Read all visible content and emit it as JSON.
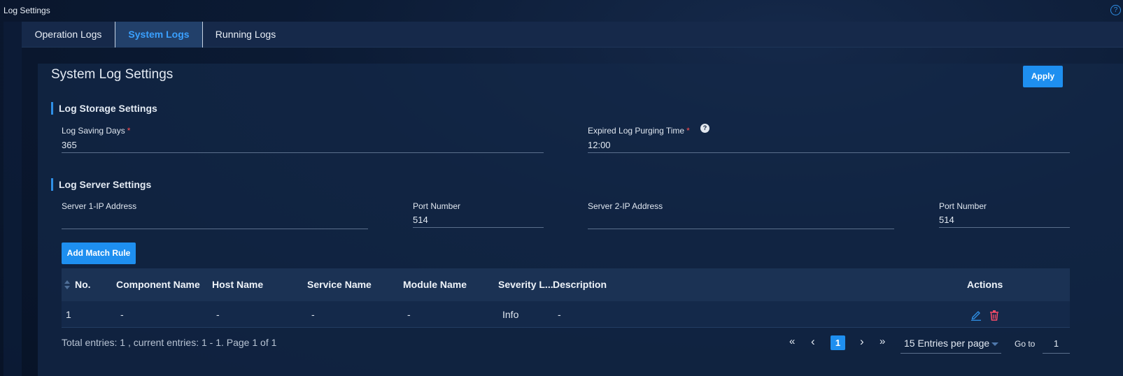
{
  "window": {
    "title": "Log Settings",
    "help_glyph": "?"
  },
  "tabs": [
    {
      "label": "Operation Logs",
      "active": false
    },
    {
      "label": "System Logs",
      "active": true
    },
    {
      "label": "Running Logs",
      "active": false
    }
  ],
  "panel": {
    "title": "System Log Settings",
    "apply_label": "Apply"
  },
  "storage": {
    "heading": "Log Storage Settings",
    "saving_days": {
      "label": "Log Saving Days",
      "required": "*",
      "value": "365"
    },
    "purging_time": {
      "label": "Expired Log Purging Time",
      "required": "*",
      "value": "12:00",
      "help_glyph": "?"
    }
  },
  "server": {
    "heading": "Log Server Settings",
    "server1_ip": {
      "label": "Server 1-IP Address",
      "value": ""
    },
    "server1_port": {
      "label": "Port Number",
      "value": "514"
    },
    "server2_ip": {
      "label": "Server 2-IP Address",
      "value": ""
    },
    "server2_port": {
      "label": "Port Number",
      "value": "514"
    }
  },
  "rules": {
    "add_label": "Add Match Rule",
    "columns": [
      "No.",
      "Component Name",
      "Host Name",
      "Service Name",
      "Module Name",
      "Severity L...",
      "Description",
      "Actions"
    ],
    "rows": [
      {
        "no": "1",
        "component": "-",
        "host": "-",
        "service": "-",
        "module": "-",
        "severity": "Info",
        "description": "-"
      }
    ]
  },
  "pagination": {
    "summary": "Total entries: 1 , current entries: 1 - 1. Page 1 of 1",
    "first_glyph": "«",
    "prev_glyph": "‹",
    "current_page": "1",
    "next_glyph": "›",
    "last_glyph": "»",
    "per_page": "15 Entries per page",
    "goto_label": "Go to",
    "goto_value": "1"
  },
  "icons": {
    "help": "help-circle-icon",
    "sort": "sort-icon",
    "edit": "edit-pencil-icon",
    "delete": "trash-icon"
  },
  "colors": {
    "accent": "#1e8ff0",
    "active_tab_text": "#3aa0ff",
    "required": "#ff4d4f",
    "delete": "#ff4d6a"
  }
}
